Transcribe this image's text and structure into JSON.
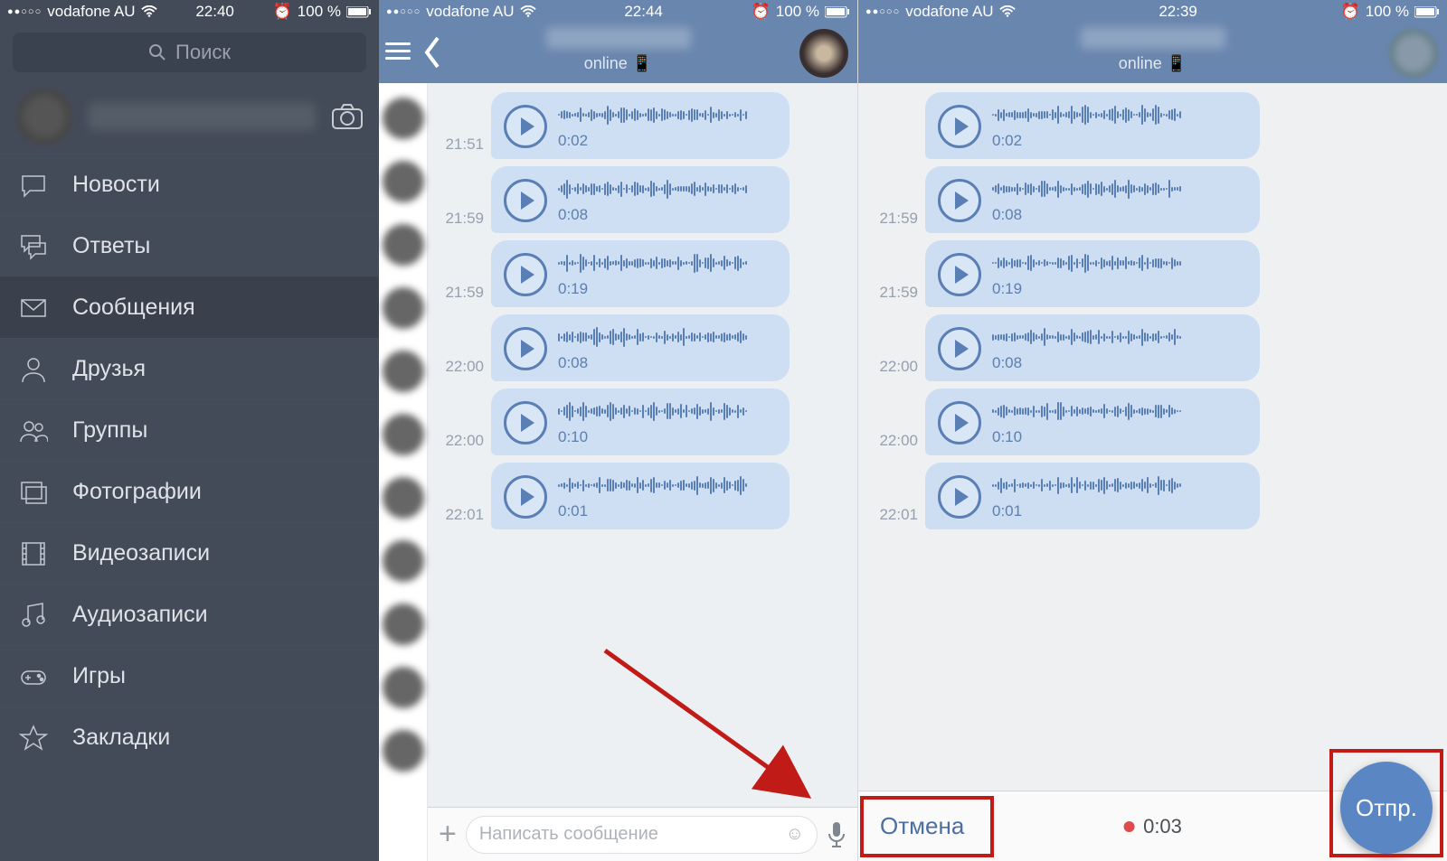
{
  "panel1": {
    "status": {
      "carrier": "vodafone AU",
      "time": "22:40",
      "battery": "100 %"
    },
    "search_placeholder": "Поиск",
    "menu": [
      {
        "icon": "chat-bubble",
        "label": "Новости"
      },
      {
        "icon": "chat-bubbles",
        "label": "Ответы"
      },
      {
        "icon": "envelope",
        "label": "Сообщения",
        "active": true
      },
      {
        "icon": "person",
        "label": "Друзья"
      },
      {
        "icon": "people",
        "label": "Группы"
      },
      {
        "icon": "photos",
        "label": "Фотографии"
      },
      {
        "icon": "film",
        "label": "Видеозаписи"
      },
      {
        "icon": "music",
        "label": "Аудиозаписи"
      },
      {
        "icon": "gamepad",
        "label": "Игры"
      },
      {
        "icon": "star",
        "label": "Закладки"
      }
    ]
  },
  "panel2": {
    "status": {
      "carrier": "vodafone AU",
      "time": "22:44",
      "battery": "100 %"
    },
    "online": "online",
    "messages": [
      {
        "ts": "21:51",
        "dur": "0:02"
      },
      {
        "ts": "21:59",
        "dur": "0:08"
      },
      {
        "ts": "21:59",
        "dur": "0:19"
      },
      {
        "ts": "22:00",
        "dur": "0:08"
      },
      {
        "ts": "22:00",
        "dur": "0:10"
      },
      {
        "ts": "22:01",
        "dur": "0:01"
      }
    ],
    "input_placeholder": "Написать сообщение"
  },
  "panel3": {
    "status": {
      "carrier": "vodafone AU",
      "time": "22:39",
      "battery": "100 %"
    },
    "online": "online",
    "messages": [
      {
        "ts": "",
        "dur": "0:02"
      },
      {
        "ts": "21:59",
        "dur": "0:08"
      },
      {
        "ts": "21:59",
        "dur": "0:19"
      },
      {
        "ts": "22:00",
        "dur": "0:08"
      },
      {
        "ts": "22:00",
        "dur": "0:10"
      },
      {
        "ts": "22:01",
        "dur": "0:01"
      }
    ],
    "cancel": "Отмена",
    "rec_time": "0:03",
    "send": "Отпр."
  }
}
